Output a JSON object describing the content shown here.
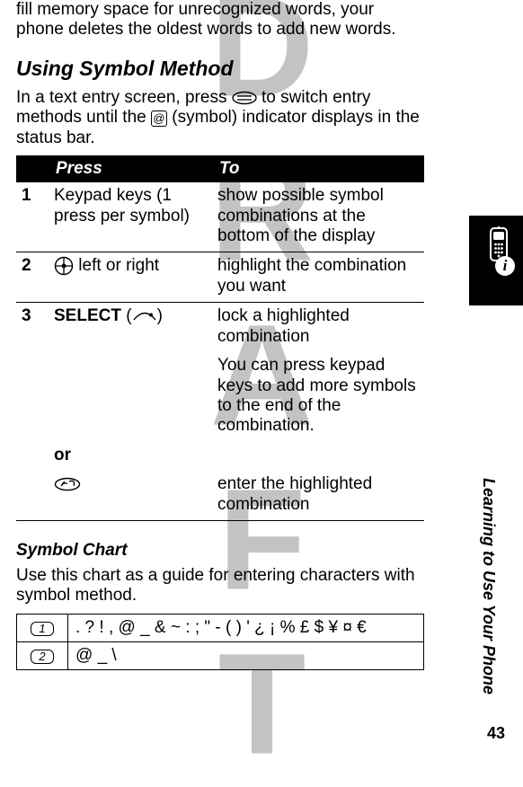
{
  "watermark": "DRAFT",
  "intro_cont": "fill memory space for unrecognized words, your phone deletes the oldest words to add new words.",
  "heading_symbol": "Using Symbol Method",
  "symbol_intro_a": "In a text entry screen, press ",
  "symbol_intro_b": " to switch entry methods until the ",
  "symbol_intro_c": " (symbol) indicator displays in the status bar.",
  "table": {
    "head": {
      "press": "Press",
      "to": "To"
    },
    "row1": {
      "num": "1",
      "press": "Keypad keys (1 press per symbol)",
      "to": "show possible symbol combinations at the bottom of the display"
    },
    "row2": {
      "num": "2",
      "press": " left or right",
      "to": " highlight the combination you want"
    },
    "row3": {
      "num": "3",
      "select": "SELECT",
      "to1": "lock a highlighted combination",
      "to2": "You can press keypad keys to add more symbols to the end of the combination."
    },
    "or": "or",
    "row4": {
      "to": "enter the highlighted combination"
    }
  },
  "chart_heading": "Symbol Chart",
  "chart_intro": "Use this chart as a guide for entering characters with symbol method.",
  "symchart": {
    "row1": ". ? ! , @ _ & ~ : ; \" - ( ) ' ¿ ¡ % £ $ ¥ ¤ €",
    "row2": "@ _ \\"
  },
  "sidelabel": "Learning to Use Your Phone",
  "pagenum": "43"
}
